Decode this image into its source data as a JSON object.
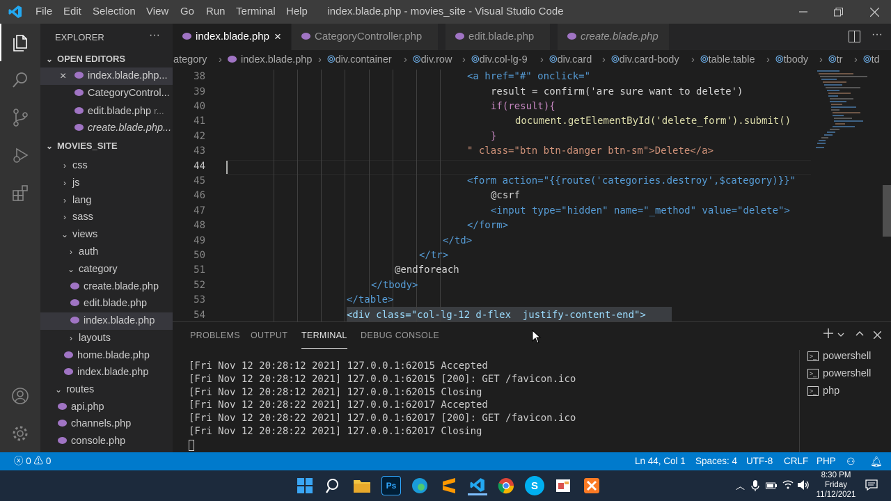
{
  "window": {
    "title": "index.blade.php - movies_site - Visual Studio Code",
    "menu": [
      "File",
      "Edit",
      "Selection",
      "View",
      "Go",
      "Run",
      "Terminal",
      "Help"
    ]
  },
  "sidebar": {
    "explorer_title": "EXPLORER",
    "more": "···",
    "open_editors_title": "OPEN EDITORS",
    "open_editors": [
      {
        "name": "index.blade.php...",
        "close": "×"
      },
      {
        "name": "CategoryControl..."
      },
      {
        "name": "edit.blade.php",
        "suffix": "r..."
      },
      {
        "name": "create.blade.php..."
      }
    ],
    "project_title": "MOVIES_SITE",
    "tree": [
      "css",
      "js",
      "lang",
      "sass",
      "views",
      "auth",
      "category",
      "create.blade.php",
      "edit.blade.php",
      "index.blade.php",
      "layouts",
      "home.blade.php",
      "index.blade.php",
      "routes",
      "api.php",
      "channels.php",
      "console.php"
    ]
  },
  "tabs": [
    {
      "label": "index.blade.php",
      "close": "×"
    },
    {
      "label": "CategoryController.php"
    },
    {
      "label": "edit.blade.php"
    },
    {
      "label": "create.blade.php"
    }
  ],
  "breadcrumbs": [
    "ategory",
    "index.blade.php",
    "div.container",
    "div.row",
    "div.col-lg-9",
    "div.card",
    "div.card-body",
    "table.table",
    "tbody",
    "tr",
    "td"
  ],
  "editor": {
    "line_numbers": [
      "38",
      "39",
      "40",
      "41",
      "42",
      "43",
      "44",
      "45",
      "46",
      "47",
      "48",
      "49",
      "50",
      "51",
      "52",
      "53",
      "54"
    ],
    "lines": [
      "<a href=\"#\" onclick=\"",
      "result = confirm('are sure want to delete')",
      "if(result){",
      "document.getElementById('delete_form').submit()",
      "}",
      "\" class=\"btn btn-danger btn-sm\">Delete</a>",
      "",
      "<form action=\"{{route('categories.destroy',$category)}}\"",
      "@csrf",
      "<input type=\"hidden\" name=\"_method\" value=\"delete\">",
      "</form>",
      "</td>",
      "</tr>",
      "@endforeach",
      "</tbody>",
      "</table>",
      "<div class=\"col-lg-12 d-flex  justify-content-end\">"
    ]
  },
  "panel": {
    "tabs": [
      "PROBLEMS",
      "OUTPUT",
      "TERMINAL",
      "DEBUG CONSOLE"
    ],
    "terminal_lines": [
      "[Fri Nov 12 20:28:12 2021] 127.0.0.1:62015 Accepted",
      "[Fri Nov 12 20:28:12 2021] 127.0.0.1:62015 [200]: GET /favicon.ico",
      "[Fri Nov 12 20:28:12 2021] 127.0.0.1:62015 Closing",
      "[Fri Nov 12 20:28:22 2021] 127.0.0.1:62017 Accepted",
      "[Fri Nov 12 20:28:22 2021] 127.0.0.1:62017 [200]: GET /favicon.ico",
      "[Fri Nov 12 20:28:22 2021] 127.0.0.1:62017 Closing"
    ],
    "shells": [
      "powershell",
      "powershell",
      "php"
    ]
  },
  "status": {
    "errors": "0",
    "warnings": "0",
    "position": "Ln 44, Col 1",
    "spaces": "Spaces: 4",
    "encoding": "UTF-8",
    "eol": "CRLF",
    "language": "PHP"
  },
  "taskbar": {
    "time": "8:30 PM",
    "day": "Friday",
    "date": "11/12/2021",
    "ps_label": "Ps",
    "s_label": "S"
  },
  "colors": {
    "accent": "#007acc",
    "php_icon": "#a074c4",
    "keyword": "#569cd6",
    "string": "#ce9178"
  }
}
